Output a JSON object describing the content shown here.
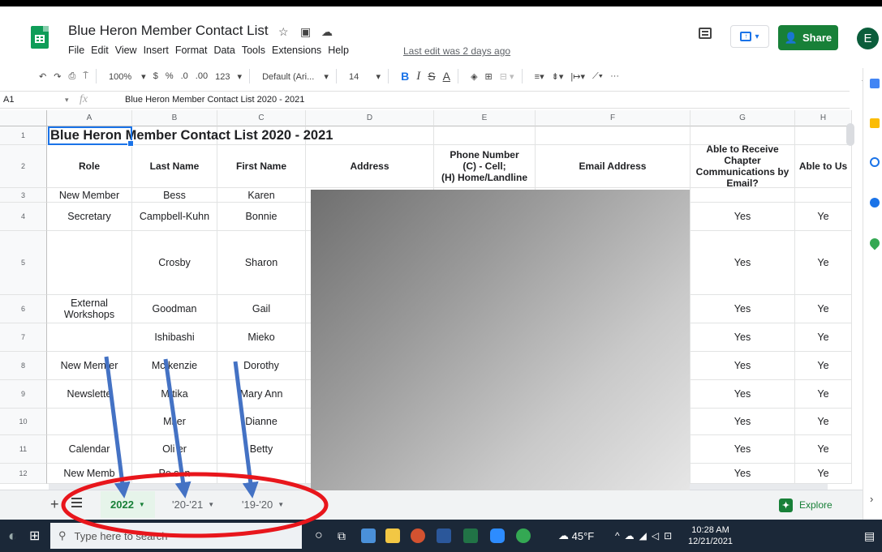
{
  "header": {
    "doc_title": "Blue Heron Member Contact List",
    "menu": [
      "File",
      "Edit",
      "View",
      "Insert",
      "Format",
      "Data",
      "Tools",
      "Extensions",
      "Help"
    ],
    "last_edit": "Last edit was 2 days ago",
    "share_label": "Share",
    "avatar_letter": "E"
  },
  "toolbar": {
    "zoom": "100%",
    "currency": "$",
    "percent": "%",
    "dec_less": ".0",
    "dec_more": ".00",
    "number_format": "123",
    "font": "Default (Ari...",
    "font_size": "14",
    "bold": "B",
    "italic": "I",
    "strike": "S",
    "text_color": "A",
    "more": "···"
  },
  "formula_bar": {
    "cell_ref": "A1",
    "fx": "fx",
    "content": "Blue Heron Member Contact List 2020 - 2021"
  },
  "columns": [
    "A",
    "B",
    "C",
    "D",
    "E",
    "F",
    "G",
    "H"
  ],
  "row_numbers": [
    "1",
    "2",
    "3",
    "4",
    "5",
    "6",
    "7",
    "8",
    "9",
    "10",
    "11",
    "12"
  ],
  "sheet": {
    "title_cell": "Blue Heron Member Contact List 2020 - 2021",
    "headers": [
      "Role",
      "Last Name",
      "First Name",
      "Address",
      "Phone Number\n(C) - Cell;\n(H) Home/Landline",
      "Email Address",
      "Able to Receive Chapter Communications by Email?",
      "Able to Us"
    ],
    "rows": [
      [
        "New Member",
        "Bess",
        "Karen",
        "",
        "",
        "",
        "",
        ""
      ],
      [
        "Secretary",
        "Campbell-Kuhn",
        "Bonnie",
        "",
        "",
        "",
        "Yes",
        "Ye"
      ],
      [
        "",
        "Crosby",
        "Sharon",
        "",
        "",
        "",
        "Yes",
        "Ye"
      ],
      [
        "External Workshops",
        "Goodman",
        "Gail",
        "",
        "",
        "",
        "Yes",
        "Ye"
      ],
      [
        "",
        "Ishibashi",
        "Mieko",
        "",
        "",
        "",
        "Yes",
        "Ye"
      ],
      [
        "New Mem er",
        "Mc kenzie",
        "Dorothy",
        "",
        "",
        "",
        "Yes",
        "Ye"
      ],
      [
        "Newslette",
        "M tika",
        "Mary Ann",
        "",
        "",
        "",
        "Yes",
        "Ye"
      ],
      [
        "",
        "Mi er",
        "Dianne",
        "",
        "",
        "",
        "Yes",
        "Ye"
      ],
      [
        "Calendar",
        "Oli er",
        "Betty",
        "",
        "",
        "",
        "Yes",
        "Ye"
      ],
      [
        "New Memb",
        "Pe son",
        "",
        "",
        "",
        "",
        "Yes",
        "Ye"
      ]
    ]
  },
  "sheet_tabs": [
    {
      "label": "2022",
      "active": true
    },
    {
      "label": "'20-'21",
      "active": false
    },
    {
      "label": "'19-'20",
      "active": false
    }
  ],
  "explore_label": "Explore",
  "taskbar": {
    "search_placeholder": "Type here to search",
    "weather": "45°F",
    "time": "10:28 AM",
    "date": "12/21/2021"
  },
  "colors": {
    "brand_green": "#188038",
    "selection_blue": "#1a73e8",
    "annotation_arrow": "#4472c4",
    "annotation_circle": "#e8161c"
  }
}
